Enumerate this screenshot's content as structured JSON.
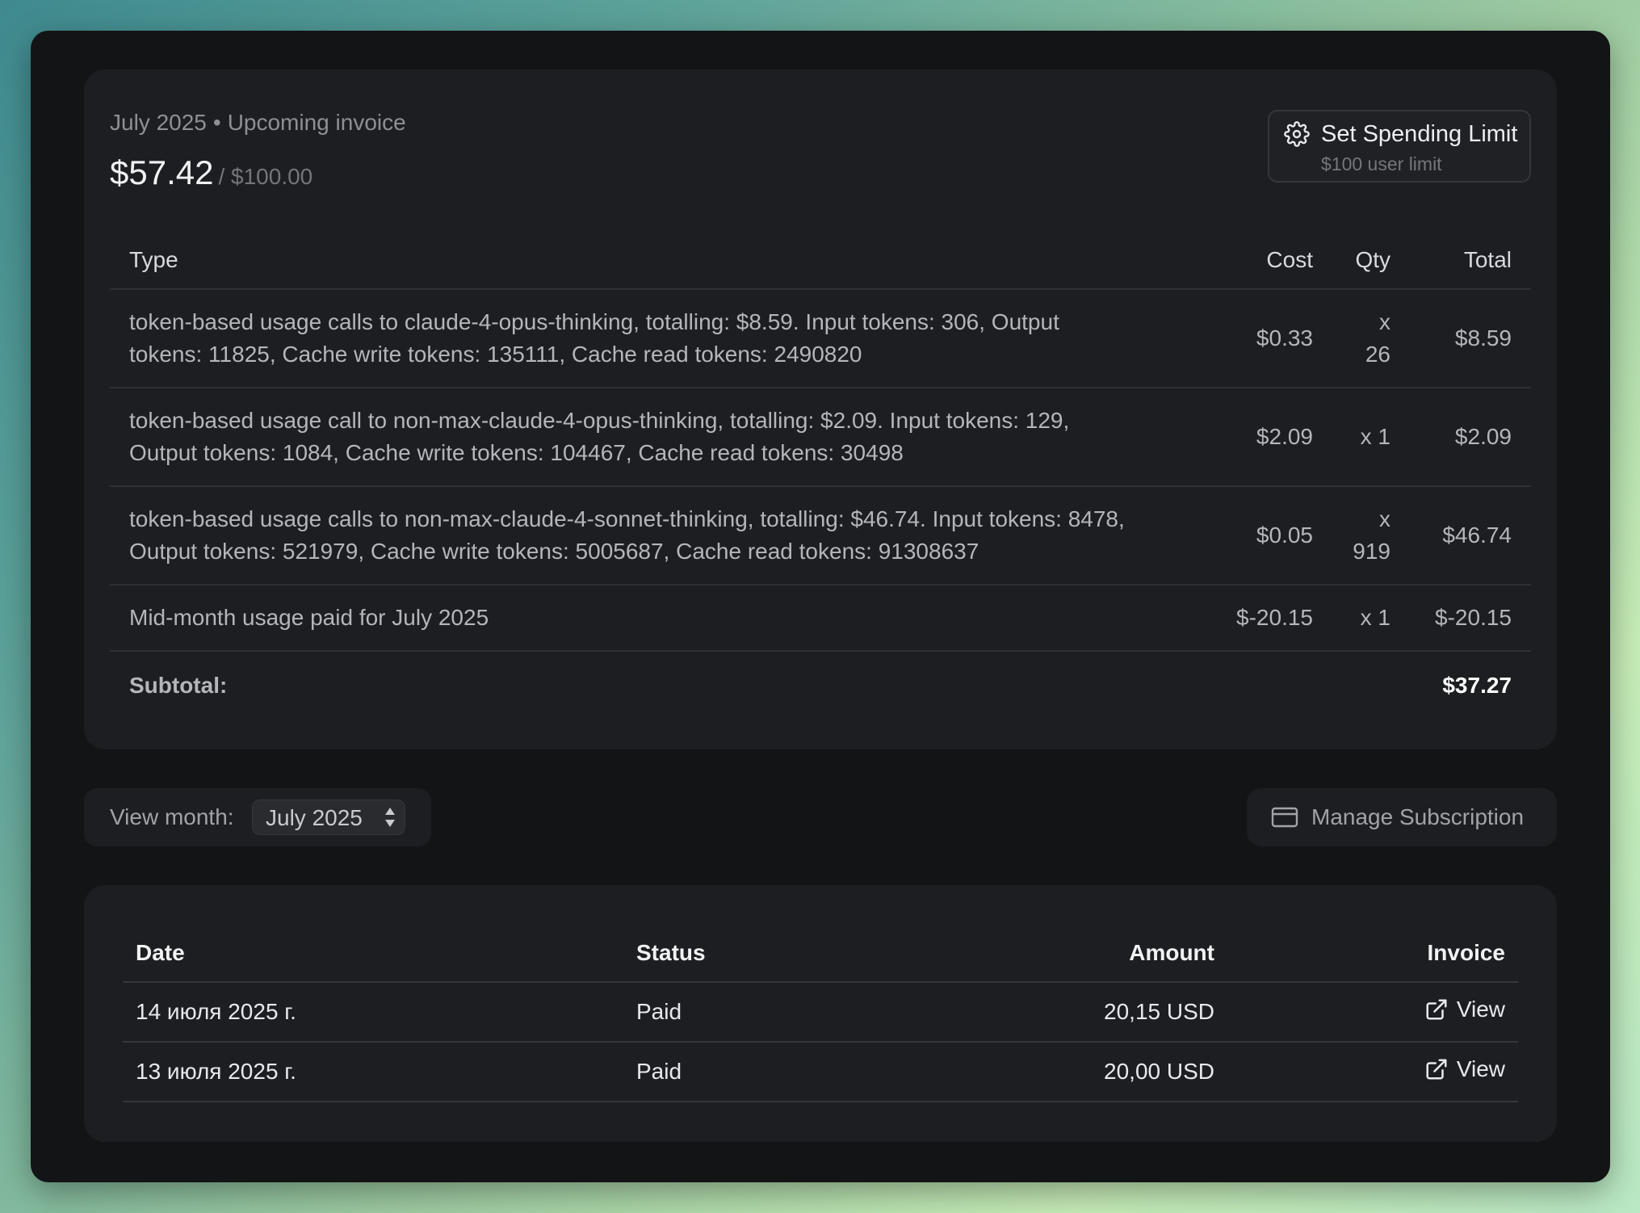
{
  "invoice": {
    "period": "July 2025",
    "separator": "•",
    "kind": "Upcoming invoice",
    "amount": "$57.42",
    "limit": "/ $100.00",
    "spending_limit_button": {
      "label": "Set Spending Limit",
      "sublabel": "$100 user limit",
      "icon": "gear-icon"
    },
    "columns": {
      "type": "Type",
      "cost": "Cost",
      "qty": "Qty",
      "total": "Total"
    },
    "items": [
      {
        "type_line1": "token-based usage calls to claude-4-opus-thinking, totalling: $8.59. Input tokens: 306, Output",
        "type_line2": "tokens: 11825, Cache write tokens: 135111, Cache read tokens: 2490820",
        "cost": "$0.33",
        "qty_line1": "x",
        "qty_line2": "26",
        "total": "$8.59"
      },
      {
        "type_line1": "token-based usage call to non-max-claude-4-opus-thinking, totalling: $2.09. Input tokens: 129,",
        "type_line2": "Output tokens: 1084, Cache write tokens: 104467, Cache read tokens: 30498",
        "cost": "$2.09",
        "qty_line1": "x 1",
        "qty_line2": "",
        "total": "$2.09"
      },
      {
        "type_line1": "token-based usage calls to non-max-claude-4-sonnet-thinking, totalling: $46.74. Input tokens: 8478,",
        "type_line2": "Output tokens: 521979, Cache write tokens: 5005687, Cache read tokens: 91308637",
        "cost": "$0.05",
        "qty_line1": "x",
        "qty_line2": "919",
        "total": "$46.74"
      }
    ],
    "midmonth": {
      "type": "Mid-month usage paid for July 2025",
      "cost": "$-20.15",
      "qty": "x 1",
      "total": "$-20.15"
    },
    "subtotal": {
      "label": "Subtotal:",
      "value": "$37.27"
    }
  },
  "controls": {
    "view_month_label": "View month:",
    "month_selected": "July 2025",
    "manage_subscription": "Manage Subscription",
    "manage_icon": "credit-card-icon"
  },
  "history": {
    "columns": {
      "date": "Date",
      "status": "Status",
      "amount": "Amount",
      "invoice": "Invoice"
    },
    "rows": [
      {
        "date": "14 июля 2025 г.",
        "status": "Paid",
        "amount": "20,15 USD",
        "invoice": "View"
      },
      {
        "date": "13 июля 2025 г.",
        "status": "Paid",
        "amount": "20,00 USD",
        "invoice": "View"
      }
    ],
    "link_icon": "external-link-icon"
  }
}
